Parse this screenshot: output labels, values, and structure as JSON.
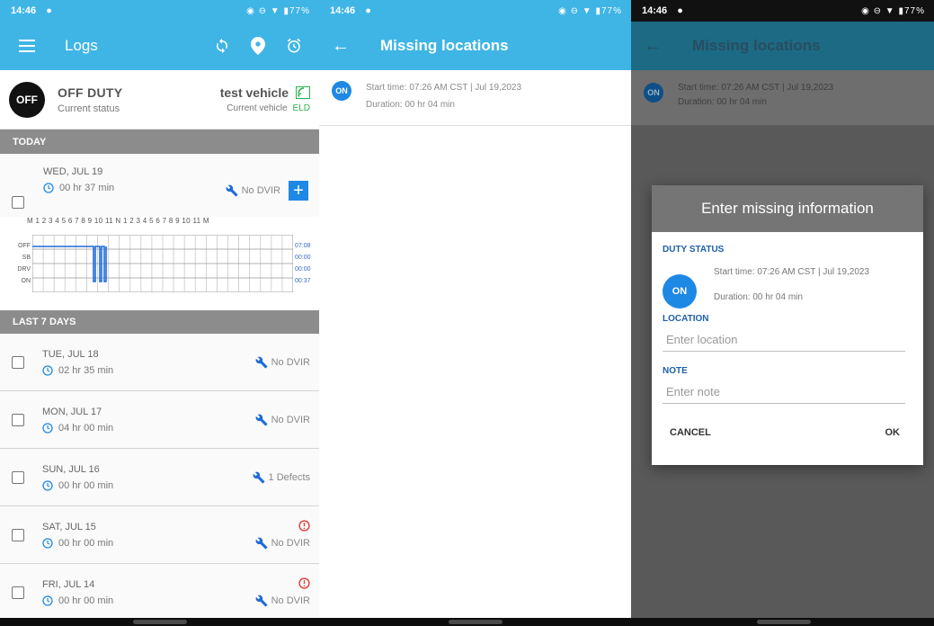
{
  "status_bar": {
    "time": "14:46",
    "battery": "77%"
  },
  "logs_screen": {
    "title": "Logs",
    "current_status": {
      "value": "OFF DUTY",
      "label": "Current status",
      "badge": "OFF"
    },
    "current_vehicle": {
      "value": "test vehicle",
      "label": "Current vehicle",
      "eld": "ELD"
    },
    "today_header": "TODAY",
    "today": {
      "date": "WED, JUL 19",
      "duration": "00 hr  37 min",
      "dvir": "No DVIR",
      "add_label": "+"
    },
    "grid": {
      "hour_labels": "M 1 2 3 4 5 6 7 8 9 10 11 N 1 2 3 4 5 6 7 8 9 10 11 M",
      "rows": [
        {
          "label": "OFF",
          "total": "07:08"
        },
        {
          "label": "SB",
          "total": "00:00"
        },
        {
          "label": "DRV",
          "total": "00:00"
        },
        {
          "label": "ON",
          "total": "00:37"
        }
      ]
    },
    "last7_header": "LAST 7 DAYS",
    "days": [
      {
        "date": "TUE, JUL 18",
        "duration": "02 hr  35 min",
        "dvir": "No DVIR",
        "warning": false
      },
      {
        "date": "MON, JUL 17",
        "duration": "04 hr  00 min",
        "dvir": "No DVIR",
        "warning": false
      },
      {
        "date": "SUN, JUL 16",
        "duration": "00 hr  00 min",
        "dvir": "1 Defects",
        "warning": false
      },
      {
        "date": "SAT, JUL 15",
        "duration": "00 hr  00 min",
        "dvir": "No DVIR",
        "warning": true
      },
      {
        "date": "FRI, JUL 14",
        "duration": "00 hr  00 min",
        "dvir": "No DVIR",
        "warning": true
      }
    ]
  },
  "missing_screen": {
    "title": "Missing locations",
    "item": {
      "badge": "ON",
      "start": "Start time: 07:26 AM CST | Jul 19,2023",
      "duration": "Duration: 00 hr  04 min"
    }
  },
  "dialog": {
    "title": "Enter missing information",
    "duty_status_label": "DUTY STATUS",
    "badge": "ON",
    "start": "Start time: 07:26 AM CST | Jul 19,2023",
    "duration": "Duration: 00 hr  04 min",
    "location_label": "LOCATION",
    "location_placeholder": "Enter location",
    "note_label": "NOTE",
    "note_placeholder": "Enter note",
    "cancel": "CANCEL",
    "ok": "OK"
  },
  "colors": {
    "app_bar": "#3fb5e5",
    "primary_blue": "#1e88e5",
    "eld_green": "#2ab24c",
    "warning_red": "#e53935"
  }
}
